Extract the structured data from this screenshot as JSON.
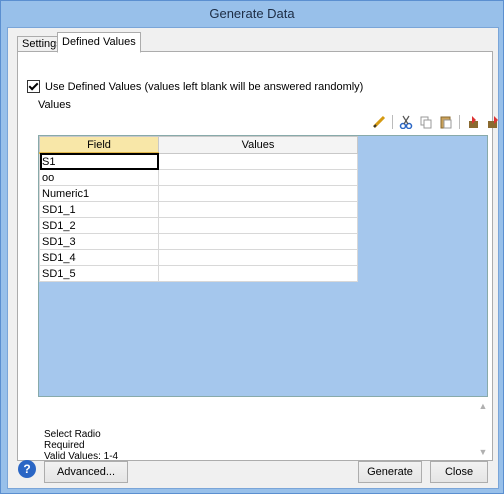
{
  "window": {
    "title": "Generate Data"
  },
  "tabs": [
    {
      "label": "Settings"
    },
    {
      "label": "Defined Values"
    }
  ],
  "use_defined": {
    "label": "Use Defined Values (values left blank will be answered randomly)",
    "checked": true
  },
  "values_label": "Values",
  "grid": {
    "columns": [
      "Field",
      "Values"
    ],
    "rows": [
      {
        "field": "S1",
        "value": ""
      },
      {
        "field": "oo",
        "value": ""
      },
      {
        "field": "Numeric1",
        "value": ""
      },
      {
        "field": "SD1_1",
        "value": ""
      },
      {
        "field": "SD1_2",
        "value": ""
      },
      {
        "field": "SD1_3",
        "value": ""
      },
      {
        "field": "SD1_4",
        "value": ""
      },
      {
        "field": "SD1_5",
        "value": ""
      }
    ]
  },
  "description": {
    "line1": "Select Radio",
    "line2": "Required",
    "line3": "Valid Values: 1-4"
  },
  "buttons": {
    "advanced": "Advanced...",
    "generate": "Generate",
    "close": "Close"
  },
  "help_glyph": "?",
  "colors": {
    "accent": "#2a66c5",
    "grid_bg": "#a5c7ed",
    "field_header": "#f8e7a8"
  },
  "toolbar_icons": [
    "pencil-icon",
    "cut-icon",
    "copy-icon",
    "paste-icon",
    "import-icon",
    "export-icon"
  ]
}
